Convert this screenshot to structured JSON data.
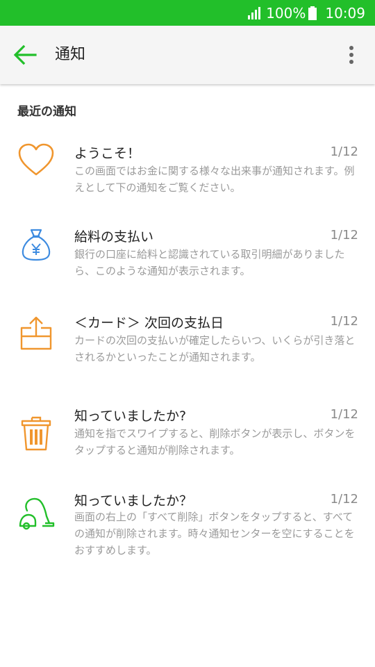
{
  "status_bar": {
    "battery": "100%",
    "time": "10:09"
  },
  "app_bar": {
    "title": "通知",
    "back_icon": "arrow-left-icon",
    "more_icon": "more-vert-icon"
  },
  "section": {
    "header": "最近の通知"
  },
  "notifications": [
    {
      "icon": "heart-icon",
      "title": "ようこそ！",
      "date": "1/12",
      "body": "この画面ではお金に関する様々な出来事が通知されます。例えとして下の通知をご覧ください。"
    },
    {
      "icon": "money-bag-icon",
      "title": "給料の支払い",
      "date": "1/12",
      "body": "銀行の口座に給料と認識されている取引明細がありましたら、このような通知が表示されます。"
    },
    {
      "icon": "box-upload-icon",
      "title": "＜カード＞ 次回の支払日",
      "date": "1/12",
      "body": "カードの次回の支払いが確定したらいつ、いくらが引き落とされるかといったことが通知されます。"
    },
    {
      "icon": "trash-icon",
      "title": "知っていましたか?",
      "date": "1/12",
      "body": "通知を指でスワイプすると、削除ボタンが表示し、ボタンをタップすると通知が削除されます。"
    },
    {
      "icon": "vacuum-cleaner-icon",
      "title": "知っていましたか？",
      "date": "1/12",
      "body": "画面の右上の「すべて削除」ボタンをタップすると、すべての通知が削除されます。時々通知センターを空にすることをおすすめします。"
    }
  ],
  "colors": {
    "status_bar": "#22bf2a",
    "accent_green": "#22bf2a",
    "orange": "#f0962e",
    "blue": "#3d8be0"
  }
}
